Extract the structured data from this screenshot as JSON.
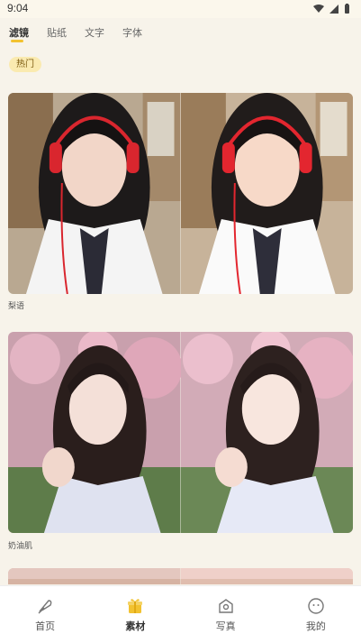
{
  "status_bar": {
    "time": "9:04"
  },
  "tabs": [
    {
      "label": "滤镜",
      "active": true
    },
    {
      "label": "贴纸",
      "active": false
    },
    {
      "label": "文字",
      "active": false
    },
    {
      "label": "字体",
      "active": false
    }
  ],
  "chip": {
    "label": "热门"
  },
  "filters": [
    {
      "name": "梨语"
    },
    {
      "name": "奶油肌"
    }
  ],
  "bottom_nav": [
    {
      "label": "首页",
      "icon": "feather-icon",
      "active": false
    },
    {
      "label": "素材",
      "icon": "gift-icon",
      "active": true
    },
    {
      "label": "写真",
      "icon": "photo-icon",
      "active": false
    },
    {
      "label": "我的",
      "icon": "smile-icon",
      "active": false
    }
  ],
  "colors": {
    "accent": "#f2c230",
    "chip_bg": "#faeab0",
    "background": "#f7f3ea"
  }
}
